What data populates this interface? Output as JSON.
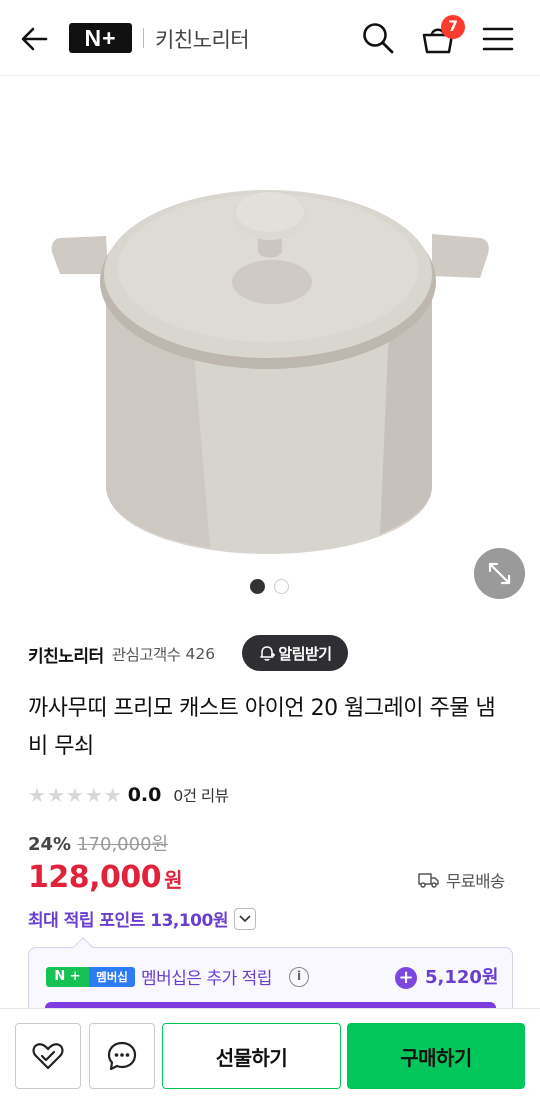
{
  "header": {
    "logo_text": "N+",
    "store_name": "키친노리터",
    "cart_count": "7",
    "icons": {
      "back": "arrow-left-icon",
      "search": "search-icon",
      "cart": "cart-icon",
      "menu": "hamburger-menu-icon"
    }
  },
  "gallery": {
    "image": "cast-iron-pot-warm-gray",
    "slide_count": 2,
    "active_slide": 1,
    "zoom_icon": "expand-icon"
  },
  "store": {
    "name": "키친노리터",
    "follow_label": "관심고객수",
    "follow_count": "426",
    "alarm_label": "알림받기",
    "alarm_icon": "bell-plus-icon"
  },
  "product": {
    "title": "까사무띠 프리모 캐스트 아이언 20 웜그레이 주물 냄비 무쇠",
    "rating": "0.0",
    "stars_filled": 0,
    "stars_total": 5,
    "review_text": "0건 리뷰"
  },
  "price": {
    "discount": "24%",
    "original": "170,000원",
    "current": "128,000",
    "currency": "원",
    "shipping": "무료배송",
    "max_points": "최대 적립 포인트 13,100원"
  },
  "membership": {
    "badge_left": "N +",
    "badge_right": "멤버십",
    "text": "멤버십은 추가 적립",
    "points": "5,120원"
  },
  "bottom": {
    "gift_label": "선물하기",
    "buy_label": "구매하기"
  },
  "colors": {
    "price_red": "#e0233a",
    "points_purple": "#6a3fd0",
    "naver_green": "#03c75a",
    "cart_badge": "#ff3b2f"
  }
}
